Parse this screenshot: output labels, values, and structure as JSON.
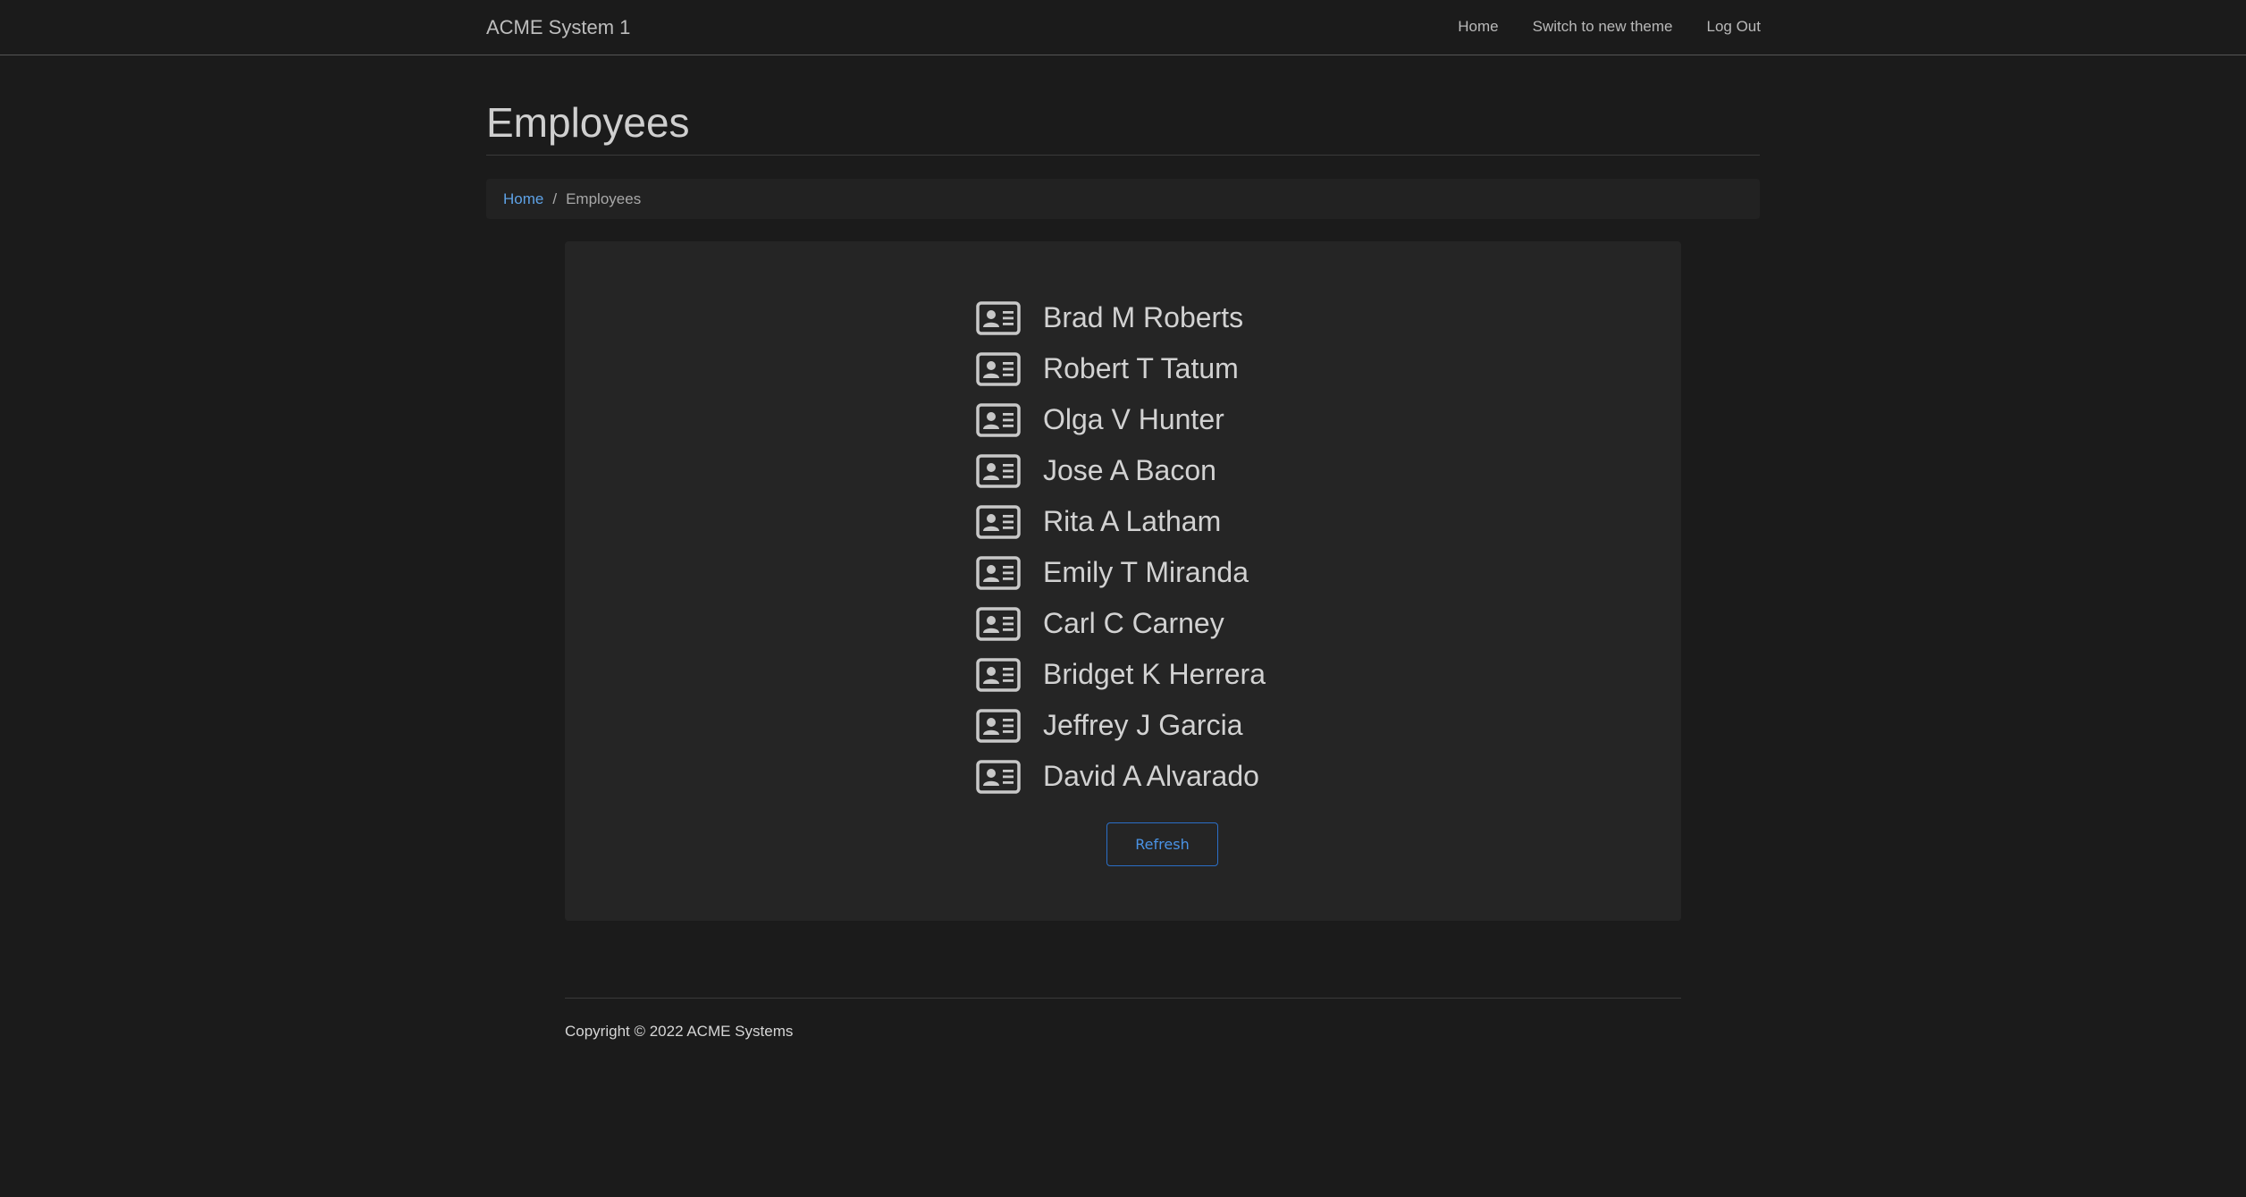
{
  "navbar": {
    "brand": "ACME System 1",
    "links": [
      "Home",
      "Switch to new theme",
      "Log Out"
    ]
  },
  "page": {
    "title": "Employees"
  },
  "breadcrumb": {
    "home": "Home",
    "separator": "/",
    "current": "Employees"
  },
  "employees": [
    {
      "name": "Brad M Roberts",
      "icon": "id-card-icon"
    },
    {
      "name": "Robert T Tatum",
      "icon": "id-card-icon"
    },
    {
      "name": "Olga V Hunter",
      "icon": "id-card-icon"
    },
    {
      "name": "Jose A Bacon",
      "icon": "id-card-icon"
    },
    {
      "name": "Rita A Latham",
      "icon": "id-card-icon"
    },
    {
      "name": "Emily T Miranda",
      "icon": "id-card-icon"
    },
    {
      "name": "Carl C Carney",
      "icon": "id-card-icon"
    },
    {
      "name": "Bridget K Herrera",
      "icon": "id-card-icon"
    },
    {
      "name": "Jeffrey J Garcia",
      "icon": "id-card-icon"
    },
    {
      "name": "David A Alvarado",
      "icon": "id-card-icon"
    }
  ],
  "actions": {
    "refresh_label": "Refresh"
  },
  "footer": {
    "copyright": "Copyright © 2022 ACME Systems"
  },
  "colors": {
    "background": "#1b1b1b",
    "panel": "#252525",
    "link": "#5ea2e6",
    "button_border": "#2b6fc7"
  }
}
